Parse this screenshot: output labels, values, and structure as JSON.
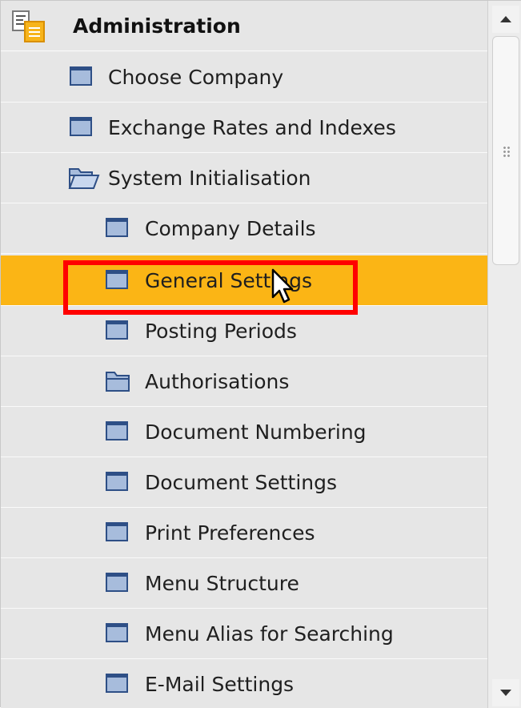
{
  "tree": {
    "header": {
      "label": "Administration",
      "icon": "admin-module-icon"
    },
    "items": [
      {
        "label": "Choose Company",
        "icon": "window-icon",
        "level": 1
      },
      {
        "label": "Exchange Rates and Indexes",
        "icon": "window-icon",
        "level": 1
      },
      {
        "label": "System Initialisation",
        "icon": "open-folder-icon",
        "level": 1
      },
      {
        "label": "Company Details",
        "icon": "window-icon",
        "level": 2
      },
      {
        "label": "General Settings",
        "icon": "window-icon",
        "level": 2,
        "selected": true
      },
      {
        "label": "Posting Periods",
        "icon": "window-icon",
        "level": 2
      },
      {
        "label": "Authorisations",
        "icon": "folder-icon",
        "level": 2
      },
      {
        "label": "Document Numbering",
        "icon": "window-icon",
        "level": 2
      },
      {
        "label": "Document Settings",
        "icon": "window-icon",
        "level": 2
      },
      {
        "label": "Print Preferences",
        "icon": "window-icon",
        "level": 2
      },
      {
        "label": "Menu Structure",
        "icon": "window-icon",
        "level": 2
      },
      {
        "label": "Menu Alias for Searching",
        "icon": "window-icon",
        "level": 2
      },
      {
        "label": "E-Mail Settings",
        "icon": "window-icon",
        "level": 2
      }
    ]
  },
  "colors": {
    "selected_row": "#fbb515",
    "highlight_box": "#ff0000",
    "row_bg": "#e6e6e6",
    "icon_fill": "#a7bcdc",
    "icon_border": "#2e4f86"
  }
}
